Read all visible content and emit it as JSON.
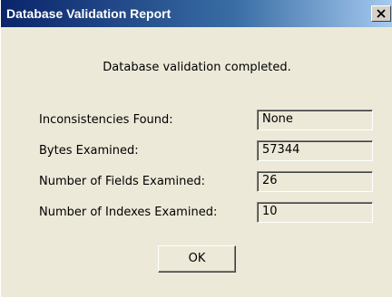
{
  "window": {
    "title": "Database Validation Report"
  },
  "message": "Database validation completed.",
  "rows": [
    {
      "label": "Inconsistencies Found:",
      "value": "None"
    },
    {
      "label": "Bytes Examined:",
      "value": "57344"
    },
    {
      "label": "Number of Fields Examined:",
      "value": "26"
    },
    {
      "label": "Number of Indexes Examined:",
      "value": "10"
    }
  ],
  "buttons": {
    "ok_label": "OK"
  },
  "icons": {
    "close": "close-icon"
  }
}
